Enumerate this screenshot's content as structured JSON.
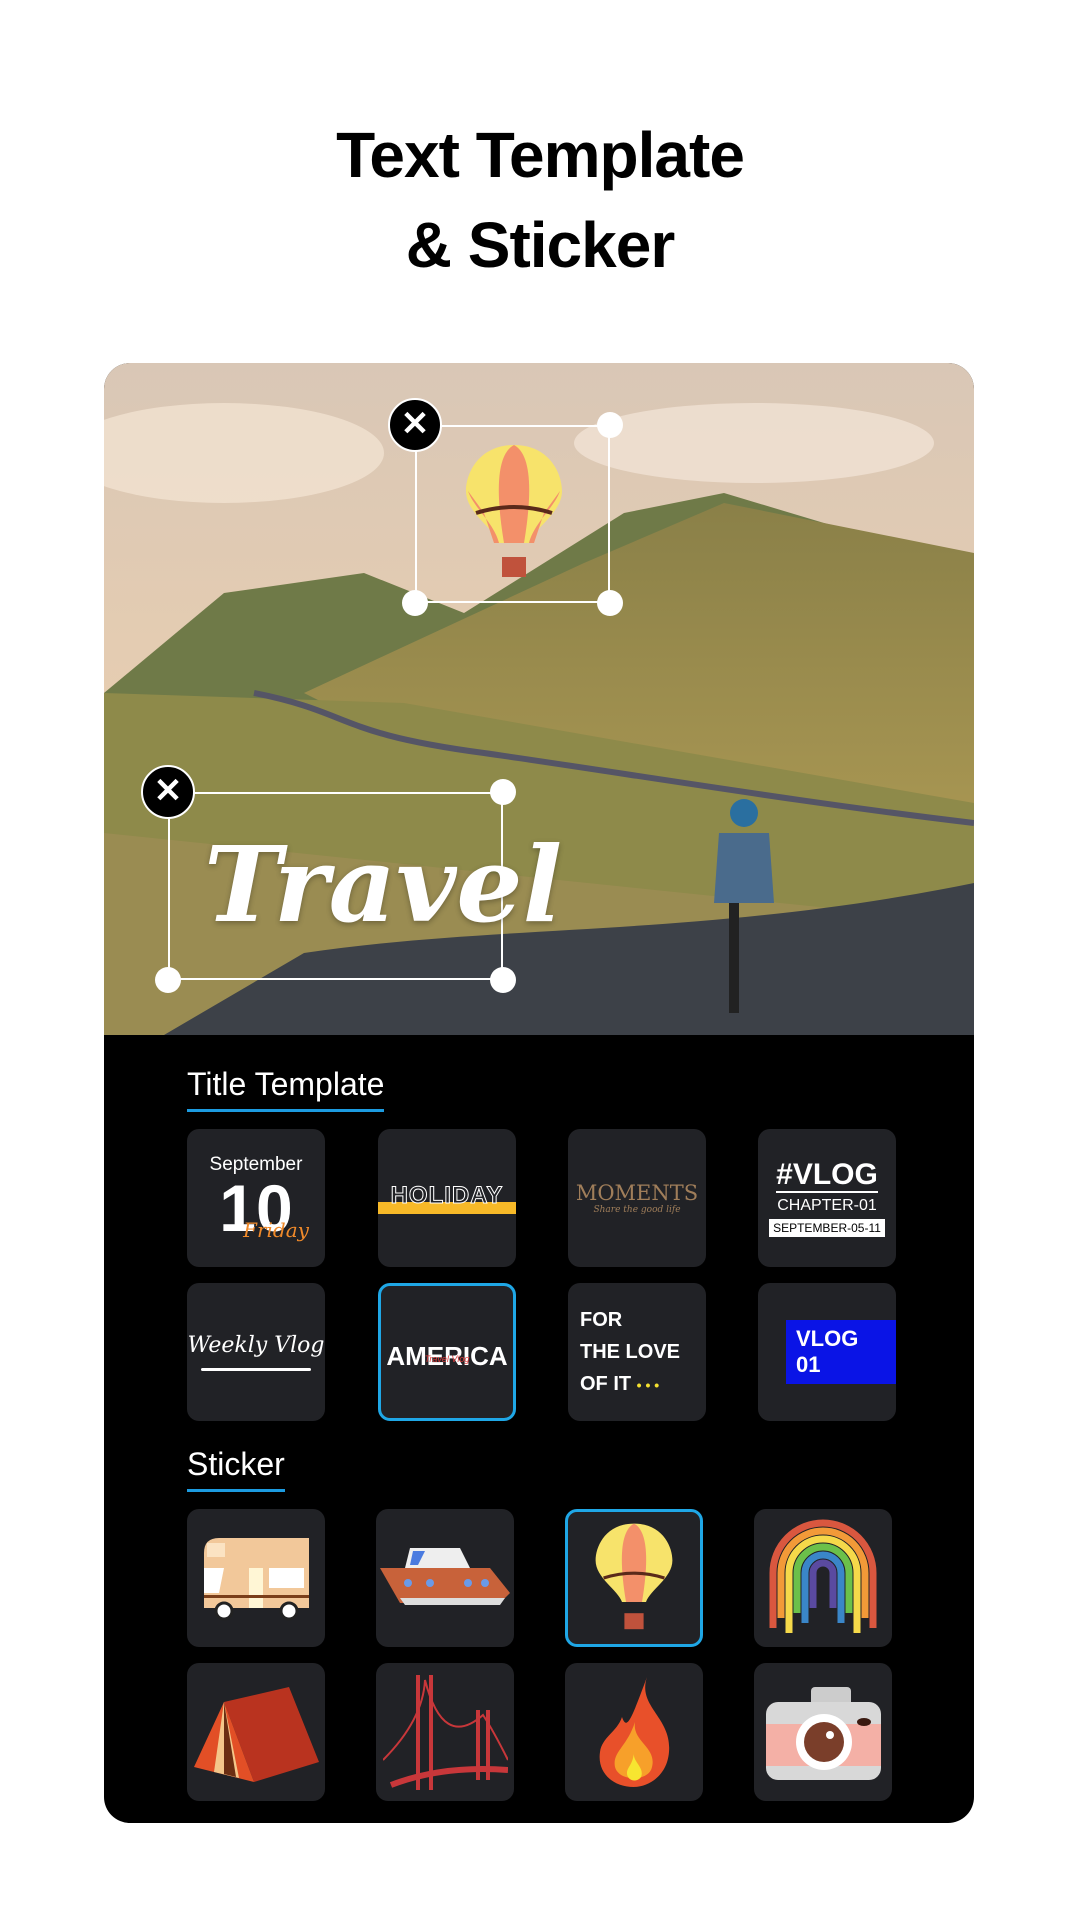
{
  "headline": {
    "line1": "Text Template",
    "line2": "& Sticker"
  },
  "editor": {
    "text_overlay": "Travel",
    "close_glyph": "✕"
  },
  "sections": {
    "title_template": "Title Template",
    "sticker": "Sticker"
  },
  "templates": [
    {
      "id": "september",
      "line1": "September",
      "line2": "10",
      "line3": "Friday"
    },
    {
      "id": "holiday",
      "line1": "HOLIDAY"
    },
    {
      "id": "moments",
      "line1": "MOMENTS",
      "line2": "Share the good life"
    },
    {
      "id": "vlog-chapter",
      "line1": "#VLOG",
      "line2": "CHAPTER-01",
      "line3": "SEPTEMBER-05-11"
    },
    {
      "id": "weekly-vlog",
      "line1": "Weekly Vlog"
    },
    {
      "id": "america",
      "line1": "AMERICA",
      "line2": "Travel Vlog",
      "selected": true
    },
    {
      "id": "for-the-love",
      "line1": "FOR",
      "line2": "THE LOVE",
      "line3": "OF IT",
      "line4": "• • •"
    },
    {
      "id": "vlog01",
      "line1": "VLOG 01"
    }
  ],
  "stickers": [
    "camper-van",
    "yacht",
    "hot-air-balloon",
    "rainbow",
    "tent",
    "golden-gate-bridge",
    "fire",
    "camera"
  ],
  "selected_sticker": "hot-air-balloon",
  "colors": {
    "accent": "#1c9be0",
    "tile_bg": "#212226",
    "vlog_blue": "#0a14e6",
    "holiday_yellow": "#f7b928"
  }
}
